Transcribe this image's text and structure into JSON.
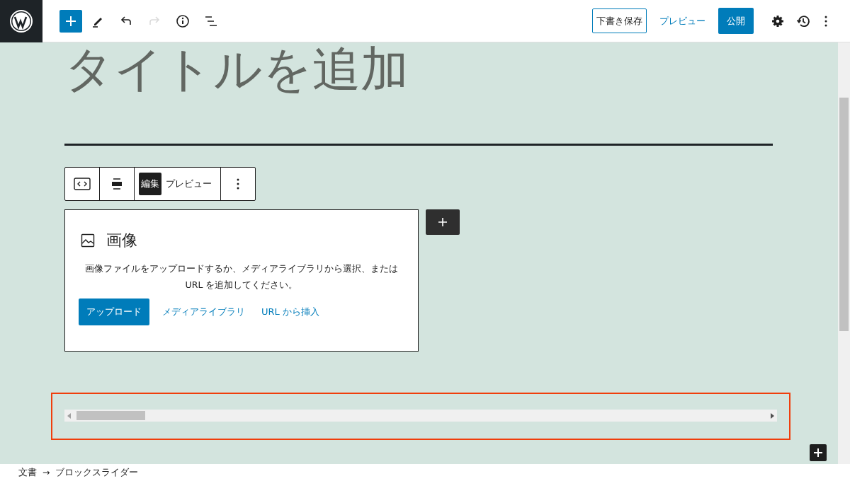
{
  "header": {
    "history": [
      {
        "kind": "undo",
        "disabled": false
      },
      {
        "kind": "redo",
        "disabled": true
      }
    ],
    "save_draft": "下書き保存",
    "preview": "プレビュー",
    "publish": "公開"
  },
  "post_title": {
    "placeholder": "タイトルを追加"
  },
  "block_toolbar": {
    "tabs": [
      {
        "label": "編集",
        "selected": true
      },
      {
        "label": "プレビュー",
        "selected": false
      }
    ]
  },
  "image_placeholder": {
    "title": "画像",
    "instructions": "画像ファイルをアップロードするか、メディアライブラリから選択、または URL を追加してください。",
    "upload": "アップロード",
    "media_library": "メディアライブラリ",
    "insert_url": "URL から挿入"
  },
  "slider_block": {
    "selected": true
  },
  "breadcrumb": {
    "items": [
      "文書",
      "ブロックスライダー"
    ],
    "separator": "→"
  }
}
